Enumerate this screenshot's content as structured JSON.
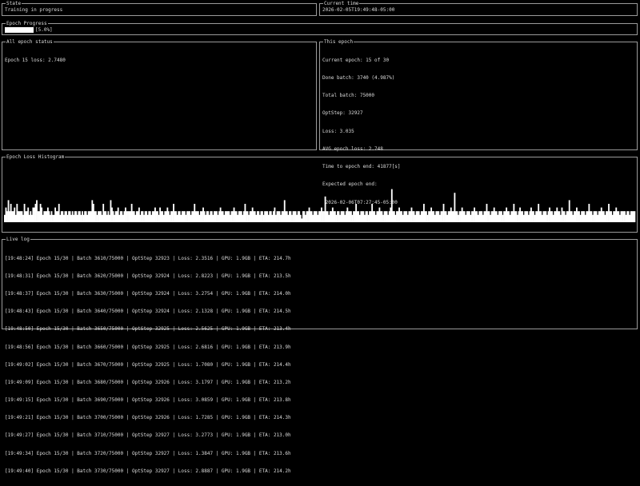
{
  "state": {
    "title": "State",
    "value": "Training in progress"
  },
  "current_time": {
    "title": "Current time",
    "value": "2026-02-05T19:49:48-05:00"
  },
  "epoch_progress": {
    "title": "Epoch Progress",
    "label": "[5.0%]",
    "fraction": 0.05
  },
  "all_epoch_status": {
    "title": "All epoch status",
    "lines": [
      "Epoch 15 loss: 2.7480"
    ]
  },
  "this_epoch": {
    "title": "This epoch",
    "lines": [
      "Current epoch: 15 of 30",
      "Done batch: 3740 (4.987%)",
      "Total batch: 75000",
      "OptStep: 32927",
      "Loss: 3.035",
      "AVG epoch loss: 2.748",
      "Time to epoch end: 41877[s]",
      "Expected epoch end:",
      " 2026-02-06T07:27:45-05:00"
    ]
  },
  "histogram": {
    "title": "Epoch Loss Histogram",
    "values": [
      2,
      4,
      3,
      6,
      3,
      5,
      3,
      3,
      4,
      2,
      5,
      3,
      3,
      3,
      3,
      2,
      5,
      3,
      3,
      4,
      2,
      3,
      2,
      4,
      4,
      5,
      6,
      3,
      3,
      5,
      4,
      2,
      3,
      3,
      3,
      4,
      3,
      2,
      3,
      2,
      2,
      4,
      3,
      3,
      5,
      2,
      3,
      3,
      2,
      3,
      3,
      2,
      3,
      3,
      2,
      3,
      2,
      3,
      3,
      2,
      3,
      3,
      2,
      3,
      2,
      3,
      3,
      2,
      3,
      3,
      3,
      6,
      5,
      3,
      3,
      2,
      3,
      3,
      3,
      2,
      5,
      3,
      3,
      2,
      3,
      2,
      6,
      4,
      3,
      2,
      3,
      3,
      4,
      2,
      3,
      3,
      2,
      3,
      4,
      3,
      3,
      3,
      3,
      5,
      3,
      3,
      2,
      3,
      3,
      4,
      2,
      3,
      3,
      2,
      3,
      3,
      2,
      3,
      3,
      2,
      3,
      3,
      4,
      3,
      3,
      2,
      4,
      3,
      3,
      2,
      3,
      3,
      4,
      3,
      2,
      3,
      3,
      5,
      3,
      3,
      2,
      3,
      3,
      2,
      3,
      3,
      3,
      2,
      3,
      3,
      3,
      2,
      3,
      3,
      5,
      3,
      3,
      3,
      2,
      3,
      3,
      4,
      3,
      2,
      3,
      3,
      2,
      3,
      3,
      2,
      3,
      3,
      3,
      2,
      3,
      4,
      3,
      3,
      2,
      3,
      3,
      3,
      3,
      2,
      3,
      3,
      4,
      3,
      3,
      2,
      3,
      3,
      3,
      2,
      3,
      5,
      3,
      3,
      2,
      3,
      3,
      4,
      3,
      3,
      2,
      3,
      3,
      2,
      3,
      3,
      2,
      3,
      3,
      3,
      2,
      3,
      3,
      2,
      3,
      4,
      2,
      3,
      3,
      3,
      2,
      3,
      3,
      6,
      3,
      3,
      2,
      3,
      3,
      2,
      3,
      3,
      3,
      2,
      3,
      3,
      2,
      1,
      3,
      3,
      2,
      3,
      3,
      4,
      3,
      3,
      2,
      3,
      3,
      3,
      2,
      3,
      3,
      4,
      3,
      3,
      7,
      3,
      3,
      2,
      3,
      3,
      4,
      3,
      3,
      2,
      3,
      3,
      2,
      3,
      3,
      3,
      2,
      3,
      4,
      3,
      3,
      3,
      2,
      3,
      3,
      5,
      3,
      3,
      2,
      3,
      3,
      3,
      2,
      3,
      3,
      2,
      3,
      3,
      5,
      3,
      3,
      2,
      3,
      3,
      4,
      3,
      3,
      2,
      3,
      3,
      3,
      2,
      3,
      4,
      9,
      3,
      3,
      2,
      3,
      3,
      4,
      3,
      3,
      2,
      3,
      3,
      3,
      2,
      3,
      3,
      4,
      3,
      3,
      2,
      3,
      3,
      3,
      2,
      3,
      3,
      5,
      3,
      3,
      2,
      3,
      3,
      4,
      3,
      3,
      2,
      3,
      3,
      3,
      2,
      3,
      3,
      5,
      3,
      3,
      2,
      3,
      3,
      4,
      3,
      3,
      8,
      3,
      3,
      2,
      3,
      3,
      4,
      3,
      3,
      2,
      3,
      3,
      3,
      2,
      3,
      3,
      4,
      3,
      3,
      2,
      3,
      3,
      3,
      2,
      3,
      3,
      5,
      3,
      3,
      2,
      3,
      3,
      4,
      3,
      3,
      2,
      3,
      3,
      3,
      2,
      3,
      3,
      4,
      3,
      3,
      2,
      3,
      3,
      5,
      3,
      3,
      2,
      3,
      4,
      3,
      3,
      2,
      3,
      3,
      3,
      2,
      3,
      4,
      3,
      3,
      2,
      3,
      3,
      5,
      3,
      3,
      2,
      3,
      3,
      3,
      2,
      3,
      4,
      3,
      3,
      2,
      3,
      3,
      4,
      3,
      3,
      2,
      4,
      3,
      3,
      2,
      3,
      3,
      6,
      3,
      3,
      2,
      3,
      3,
      4,
      3,
      3,
      2,
      3,
      3,
      3,
      2,
      3,
      3,
      5,
      3,
      3,
      2,
      3,
      3,
      3,
      2,
      3,
      3,
      4,
      3,
      3,
      2,
      3,
      3,
      5,
      3,
      3,
      2,
      3,
      3,
      4,
      3,
      3,
      2,
      3,
      3,
      3,
      3,
      2,
      3,
      3,
      2,
      3,
      3,
      3,
      3
    ]
  },
  "live_log": {
    "title": "Live log",
    "lines": [
      "[19:48:24] Epoch 15/30 | Batch 3610/75000 | OptStep 32923 | Loss: 2.3516 | GPU: 1.9GB | ETA: 214.7h",
      "[19:48:31] Epoch 15/30 | Batch 3620/75000 | OptStep 32924 | Loss: 2.8223 | GPU: 1.9GB | ETA: 213.5h",
      "[19:48:37] Epoch 15/30 | Batch 3630/75000 | OptStep 32924 | Loss: 3.2754 | GPU: 1.9GB | ETA: 214.0h",
      "[19:48:43] Epoch 15/30 | Batch 3640/75000 | OptStep 32924 | Loss: 2.1328 | GPU: 1.9GB | ETA: 214.5h",
      "[19:48:50] Epoch 15/30 | Batch 3650/75000 | OptStep 32925 | Loss: 2.5625 | GPU: 1.9GB | ETA: 213.4h",
      "[19:48:56] Epoch 15/30 | Batch 3660/75000 | OptStep 32925 | Loss: 2.6816 | GPU: 1.9GB | ETA: 213.9h",
      "[19:49:02] Epoch 15/30 | Batch 3670/75000 | OptStep 32925 | Loss: 1.7080 | GPU: 1.9GB | ETA: 214.4h",
      "[19:49:09] Epoch 15/30 | Batch 3680/75000 | OptStep 32926 | Loss: 3.1797 | GPU: 1.9GB | ETA: 213.2h",
      "[19:49:15] Epoch 15/30 | Batch 3690/75000 | OptStep 32926 | Loss: 3.0859 | GPU: 1.9GB | ETA: 213.8h",
      "[19:49:21] Epoch 15/30 | Batch 3700/75000 | OptStep 32926 | Loss: 1.7285 | GPU: 1.9GB | ETA: 214.3h",
      "[19:49:27] Epoch 15/30 | Batch 3710/75000 | OptStep 32927 | Loss: 3.2773 | GPU: 1.9GB | ETA: 213.0h",
      "[19:49:34] Epoch 15/30 | Batch 3720/75000 | OptStep 32927 | Loss: 1.3847 | GPU: 1.9GB | ETA: 213.6h",
      "[19:49:40] Epoch 15/30 | Batch 3730/75000 | OptStep 32927 | Loss: 2.8887 | GPU: 1.9GB | ETA: 214.2h"
    ]
  }
}
